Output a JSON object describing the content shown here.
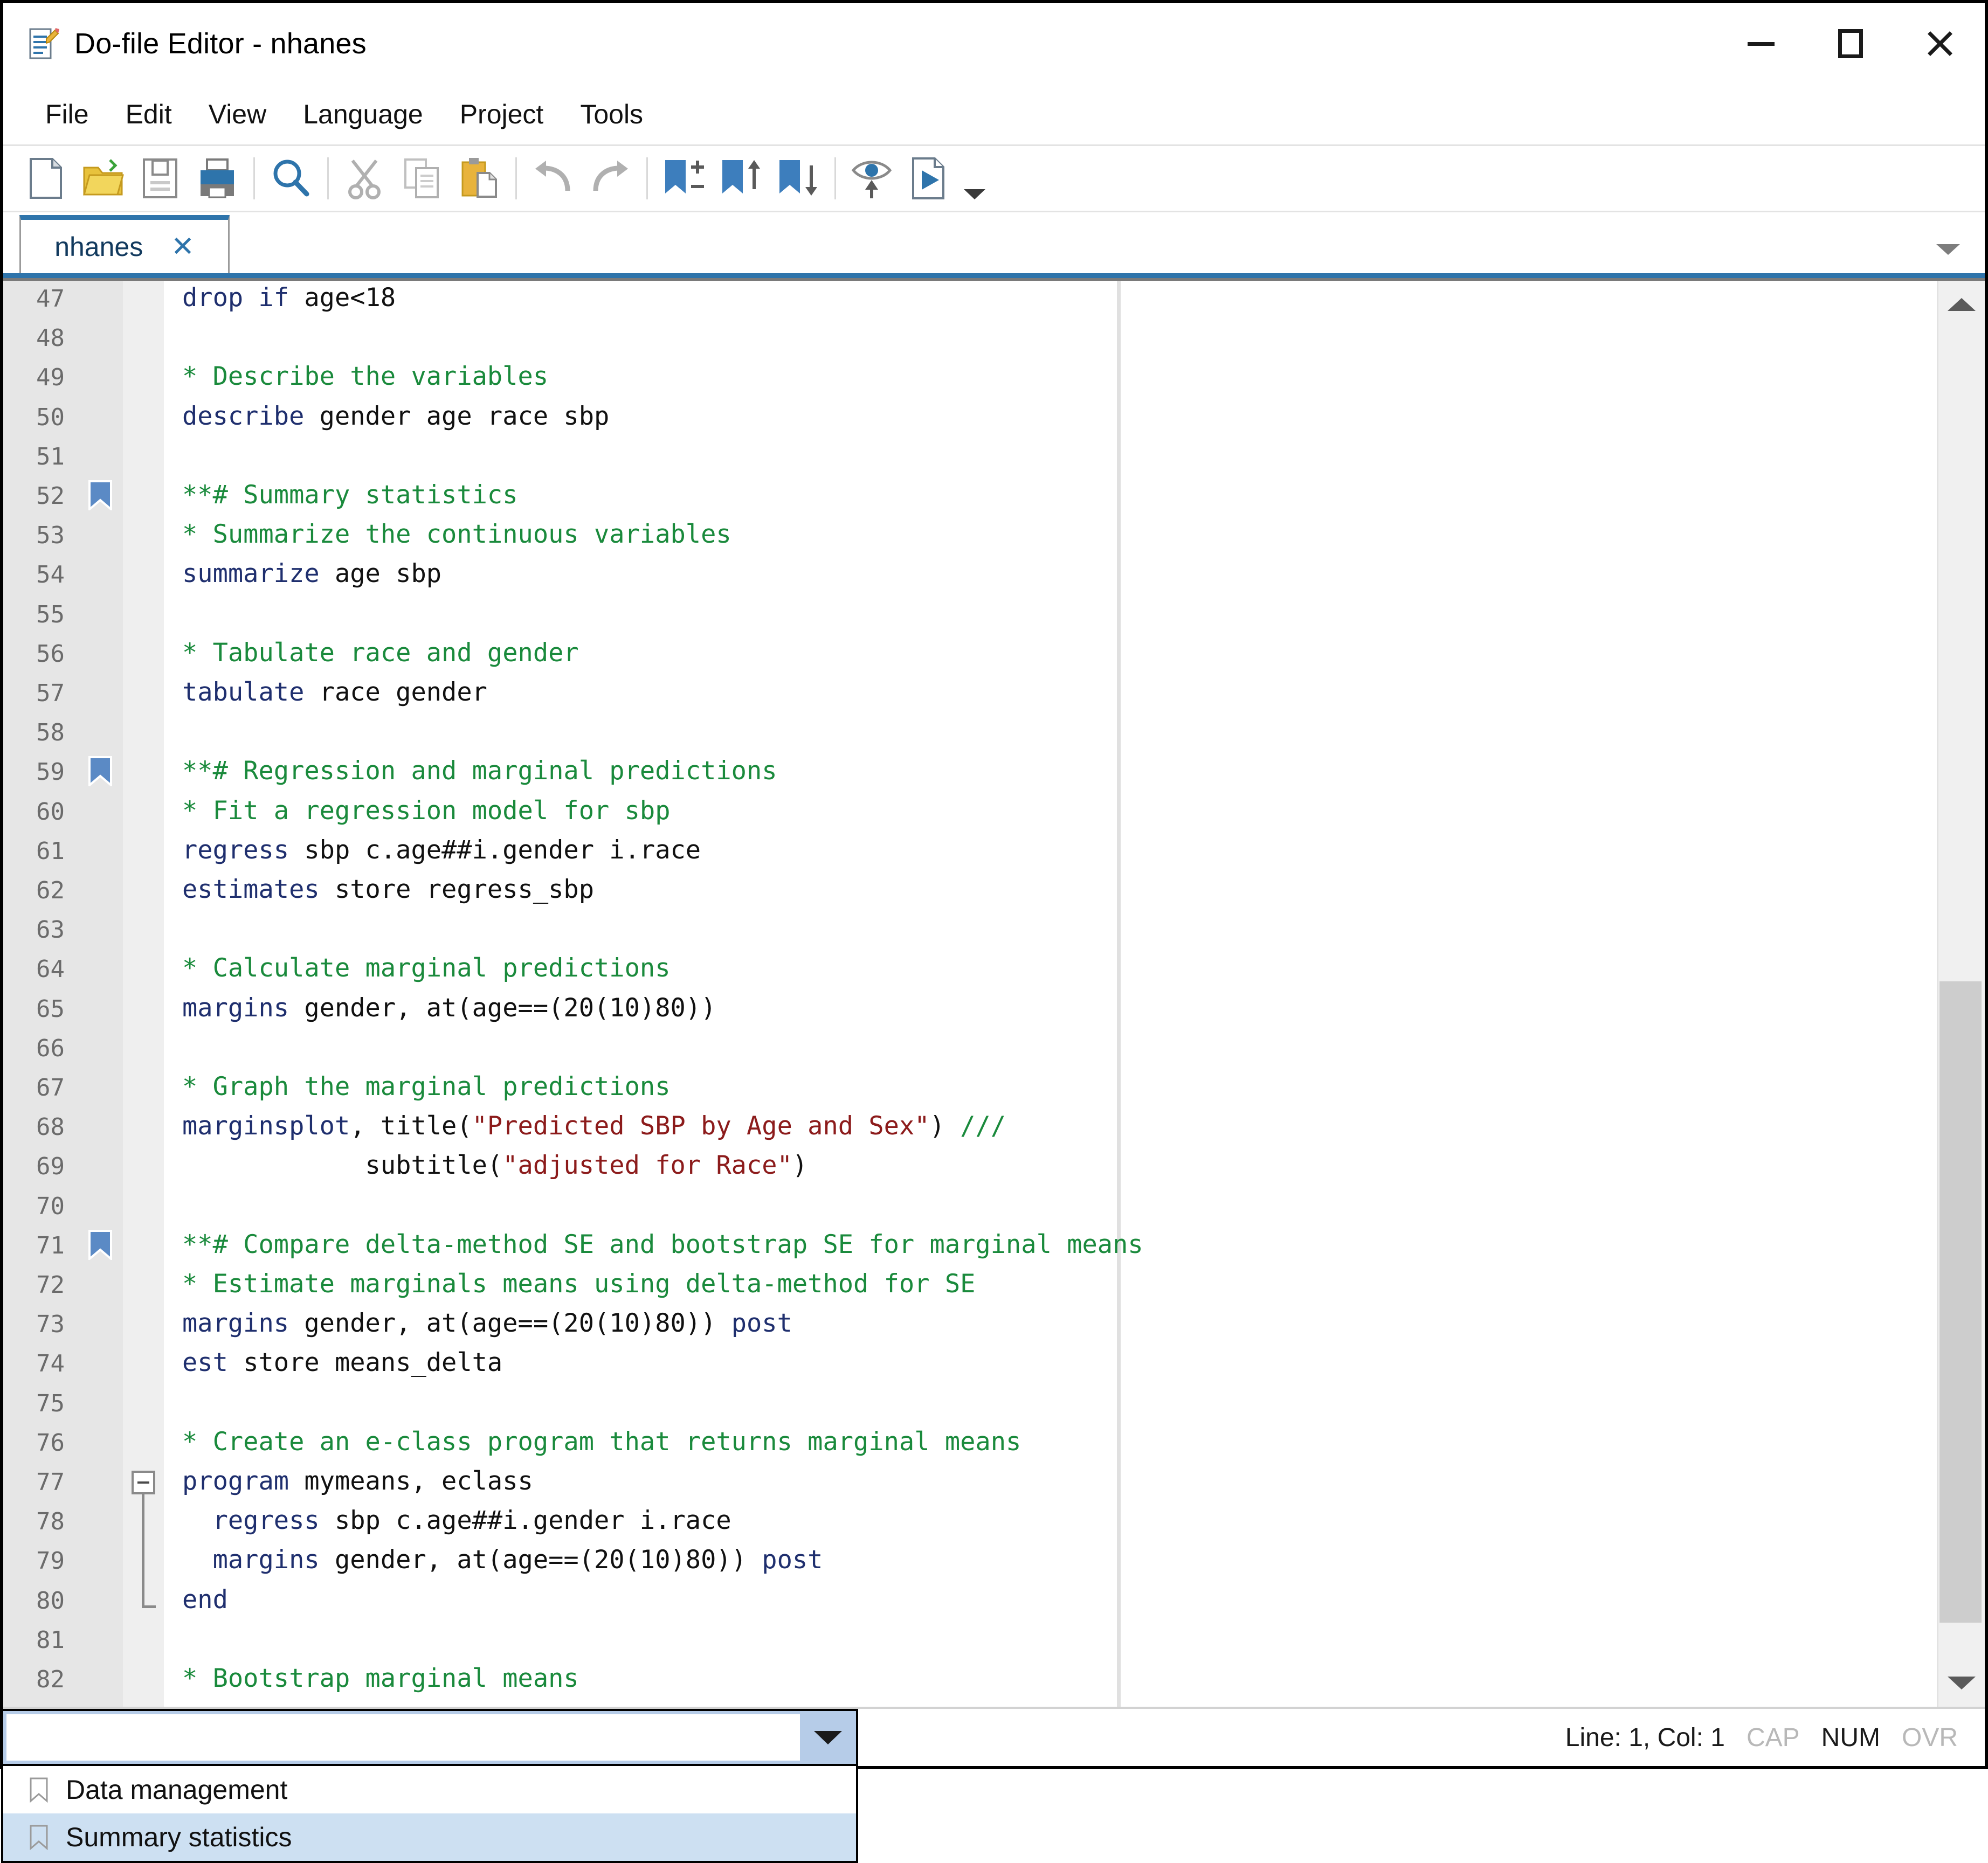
{
  "window": {
    "title": "Do-file Editor - nhanes",
    "icon": "dofile-editor-icon",
    "controls": [
      {
        "name": "minimize-button",
        "glyph": "minimize-icon"
      },
      {
        "name": "maximize-button",
        "glyph": "maximize-icon"
      },
      {
        "name": "close-button",
        "glyph": "close-icon"
      }
    ]
  },
  "menubar": {
    "items": [
      {
        "label": "File",
        "name": "menu-file"
      },
      {
        "label": "Edit",
        "name": "menu-edit"
      },
      {
        "label": "View",
        "name": "menu-view"
      },
      {
        "label": "Language",
        "name": "menu-language"
      },
      {
        "label": "Project",
        "name": "menu-project"
      },
      {
        "label": "Tools",
        "name": "menu-tools"
      }
    ]
  },
  "toolbar": {
    "buttons": [
      {
        "icon": "new-document-icon",
        "name": "new-button"
      },
      {
        "icon": "open-folder-icon",
        "name": "open-button"
      },
      {
        "icon": "save-disk-icon",
        "name": "save-button"
      },
      {
        "icon": "printer-icon",
        "name": "print-button"
      },
      {
        "icon": "search-icon",
        "name": "find-button"
      },
      {
        "icon": "scissors-icon",
        "name": "cut-button"
      },
      {
        "icon": "copy-icon",
        "name": "copy-button"
      },
      {
        "icon": "clipboard-paste-icon",
        "name": "paste-button"
      },
      {
        "icon": "undo-arrow-icon",
        "name": "undo-button"
      },
      {
        "icon": "redo-arrow-icon",
        "name": "redo-button"
      },
      {
        "icon": "bookmark-toggle-icon",
        "name": "toggle-bookmark-button"
      },
      {
        "icon": "bookmark-up-icon",
        "name": "previous-bookmark-button"
      },
      {
        "icon": "bookmark-down-icon",
        "name": "next-bookmark-button"
      },
      {
        "icon": "preview-eye-icon",
        "name": "preview-button"
      },
      {
        "icon": "run-document-icon",
        "name": "execute-button"
      },
      {
        "icon": "chevron-down-icon",
        "name": "execute-dropdown-button"
      }
    ]
  },
  "tabs": {
    "active": "nhanes",
    "close_glyph": "✕",
    "overflow_icon": "chevron-down-icon"
  },
  "editor": {
    "first_line": 47,
    "bookmarked_lines": [
      52,
      59,
      71
    ],
    "fold_start_line": 77,
    "fold_end_line": 80,
    "lines": [
      {
        "n": 47,
        "tokens": [
          {
            "t": "drop if ",
            "c": "cmd"
          },
          {
            "t": "age<18",
            "c": "plain"
          }
        ]
      },
      {
        "n": 48,
        "tokens": []
      },
      {
        "n": 49,
        "tokens": [
          {
            "t": "* Describe the variables",
            "c": "cmt"
          }
        ]
      },
      {
        "n": 50,
        "tokens": [
          {
            "t": "describe ",
            "c": "cmd"
          },
          {
            "t": "gender age race sbp",
            "c": "plain"
          }
        ]
      },
      {
        "n": 51,
        "tokens": []
      },
      {
        "n": 52,
        "tokens": [
          {
            "t": "**# Summary statistics",
            "c": "cmt"
          }
        ]
      },
      {
        "n": 53,
        "tokens": [
          {
            "t": "* Summarize the continuous variables",
            "c": "cmt"
          }
        ]
      },
      {
        "n": 54,
        "tokens": [
          {
            "t": "summarize ",
            "c": "cmd"
          },
          {
            "t": "age sbp",
            "c": "plain"
          }
        ]
      },
      {
        "n": 55,
        "tokens": []
      },
      {
        "n": 56,
        "tokens": [
          {
            "t": "* Tabulate race and gender",
            "c": "cmt"
          }
        ]
      },
      {
        "n": 57,
        "tokens": [
          {
            "t": "tabulate ",
            "c": "cmd"
          },
          {
            "t": "race gender",
            "c": "plain"
          }
        ]
      },
      {
        "n": 58,
        "tokens": []
      },
      {
        "n": 59,
        "tokens": [
          {
            "t": "**# Regression and marginal predictions",
            "c": "cmt"
          }
        ]
      },
      {
        "n": 60,
        "tokens": [
          {
            "t": "* Fit a regression model for sbp",
            "c": "cmt"
          }
        ]
      },
      {
        "n": 61,
        "tokens": [
          {
            "t": "regress ",
            "c": "cmd"
          },
          {
            "t": "sbp c.age##i.gender i.race",
            "c": "plain"
          }
        ]
      },
      {
        "n": 62,
        "tokens": [
          {
            "t": "estimates ",
            "c": "cmd"
          },
          {
            "t": "store regress_sbp",
            "c": "plain"
          }
        ]
      },
      {
        "n": 63,
        "tokens": []
      },
      {
        "n": 64,
        "tokens": [
          {
            "t": "* Calculate marginal predictions",
            "c": "cmt"
          }
        ]
      },
      {
        "n": 65,
        "tokens": [
          {
            "t": "margins ",
            "c": "cmd"
          },
          {
            "t": "gender, at(age==(20(10)80))",
            "c": "plain"
          }
        ]
      },
      {
        "n": 66,
        "tokens": []
      },
      {
        "n": 67,
        "tokens": [
          {
            "t": "* Graph the marginal predictions",
            "c": "cmt"
          }
        ]
      },
      {
        "n": 68,
        "tokens": [
          {
            "t": "marginsplot",
            "c": "cmd"
          },
          {
            "t": ", title(",
            "c": "plain"
          },
          {
            "t": "\"Predicted SBP by Age and Sex\"",
            "c": "str"
          },
          {
            "t": ") ",
            "c": "plain"
          },
          {
            "t": "///",
            "c": "cmt"
          }
        ]
      },
      {
        "n": 69,
        "tokens": [
          {
            "t": "            subtitle(",
            "c": "plain"
          },
          {
            "t": "\"adjusted for Race\"",
            "c": "str"
          },
          {
            "t": ")",
            "c": "plain"
          }
        ]
      },
      {
        "n": 70,
        "tokens": []
      },
      {
        "n": 71,
        "tokens": [
          {
            "t": "**# Compare delta-method SE and bootstrap SE for marginal means",
            "c": "cmt"
          }
        ]
      },
      {
        "n": 72,
        "tokens": [
          {
            "t": "* Estimate marginals means using delta-method for SE",
            "c": "cmt"
          }
        ]
      },
      {
        "n": 73,
        "tokens": [
          {
            "t": "margins ",
            "c": "cmd"
          },
          {
            "t": "gender, at(age==(20(10)80)) ",
            "c": "plain"
          },
          {
            "t": "post",
            "c": "cmd"
          }
        ]
      },
      {
        "n": 74,
        "tokens": [
          {
            "t": "est ",
            "c": "cmd"
          },
          {
            "t": "store means_delta",
            "c": "plain"
          }
        ]
      },
      {
        "n": 75,
        "tokens": []
      },
      {
        "n": 76,
        "tokens": [
          {
            "t": "* Create an e-class program that returns marginal means",
            "c": "cmt"
          }
        ]
      },
      {
        "n": 77,
        "tokens": [
          {
            "t": "program ",
            "c": "cmd"
          },
          {
            "t": "mymeans, eclass",
            "c": "plain"
          }
        ]
      },
      {
        "n": 78,
        "tokens": [
          {
            "t": "  regress ",
            "c": "cmd"
          },
          {
            "t": "sbp c.age##i.gender i.race",
            "c": "plain"
          }
        ]
      },
      {
        "n": 79,
        "tokens": [
          {
            "t": "  margins ",
            "c": "cmd"
          },
          {
            "t": "gender, at(age==(20(10)80)) ",
            "c": "plain"
          },
          {
            "t": "post",
            "c": "cmd"
          }
        ]
      },
      {
        "n": 80,
        "tokens": [
          {
            "t": "end",
            "c": "cmd"
          }
        ]
      },
      {
        "n": 81,
        "tokens": []
      },
      {
        "n": 82,
        "tokens": [
          {
            "t": "* Bootstrap marginal means",
            "c": "cmt"
          }
        ]
      }
    ],
    "colors": {
      "command": "#1f2f6e",
      "comment": "#1a8a3c",
      "string": "#8c1b1b",
      "plain": "#111111",
      "gutter_bg": "#e6e6e6",
      "bookmark": "#5b8ac5",
      "accent": "#2e74ab"
    }
  },
  "scrollbar": {
    "up_icon": "chevron-up-icon",
    "down_icon": "chevron-down-icon"
  },
  "statusbar": {
    "combo_value": "",
    "combo_placeholder": "",
    "dropdown_icon": "chevron-down-icon",
    "position": "Line: 1, Col: 1",
    "cap": "CAP",
    "num": "NUM",
    "ovr": "OVR"
  },
  "dropdown": {
    "items": [
      {
        "label": "Data management",
        "selected": false,
        "icon": "bookmark-outline-icon"
      },
      {
        "label": "Summary statistics",
        "selected": true,
        "icon": "bookmark-outline-icon"
      }
    ]
  }
}
